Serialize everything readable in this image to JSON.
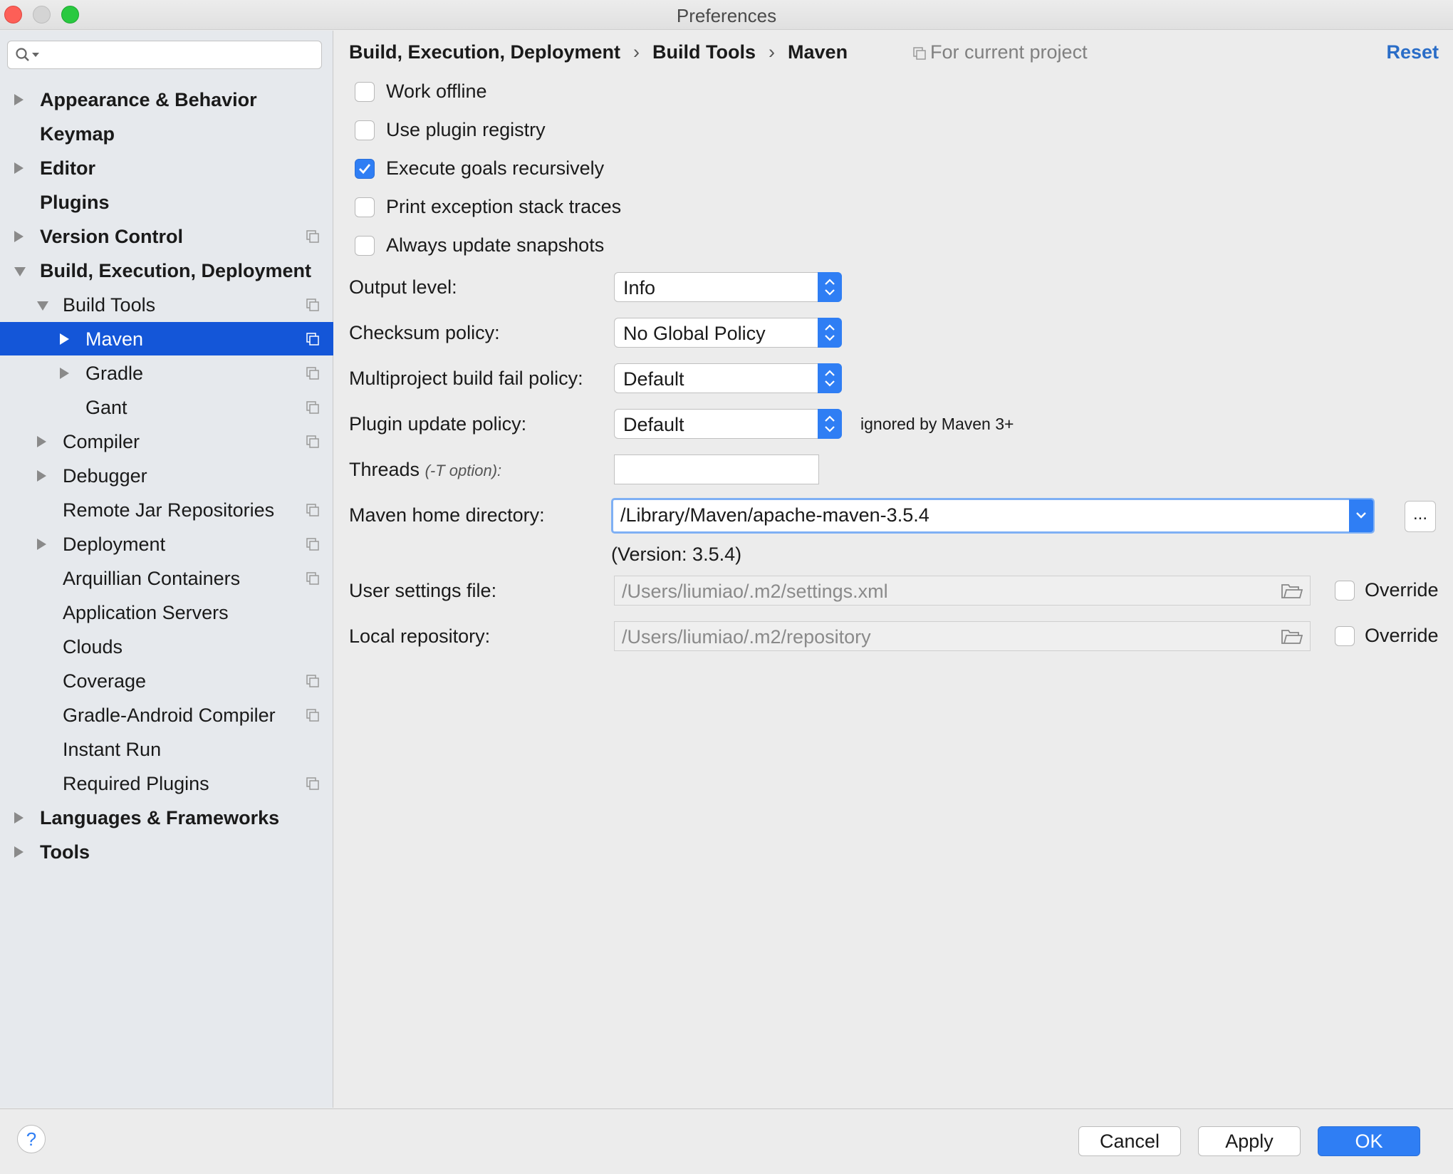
{
  "window": {
    "title": "Preferences"
  },
  "sidebar": {
    "items": [
      {
        "label": "Appearance & Behavior",
        "level": 0,
        "arrow": "right",
        "bold": true,
        "proj": false
      },
      {
        "label": "Keymap",
        "level": 0,
        "arrow": "none",
        "bold": true,
        "proj": false
      },
      {
        "label": "Editor",
        "level": 0,
        "arrow": "right",
        "bold": true,
        "proj": false
      },
      {
        "label": "Plugins",
        "level": 0,
        "arrow": "none",
        "bold": true,
        "proj": false
      },
      {
        "label": "Version Control",
        "level": 0,
        "arrow": "right",
        "bold": true,
        "proj": true
      },
      {
        "label": "Build, Execution, Deployment",
        "level": 0,
        "arrow": "down",
        "bold": true,
        "proj": false
      },
      {
        "label": "Build Tools",
        "level": 1,
        "arrow": "down",
        "bold": false,
        "proj": true
      },
      {
        "label": "Maven",
        "level": 2,
        "arrow": "right",
        "bold": false,
        "proj": true,
        "selected": true
      },
      {
        "label": "Gradle",
        "level": 2,
        "arrow": "right",
        "bold": false,
        "proj": true
      },
      {
        "label": "Gant",
        "level": 2,
        "arrow": "none",
        "bold": false,
        "proj": true
      },
      {
        "label": "Compiler",
        "level": 1,
        "arrow": "right",
        "bold": false,
        "proj": true
      },
      {
        "label": "Debugger",
        "level": 1,
        "arrow": "right",
        "bold": false,
        "proj": false
      },
      {
        "label": "Remote Jar Repositories",
        "level": 1,
        "arrow": "none",
        "bold": false,
        "proj": true
      },
      {
        "label": "Deployment",
        "level": 1,
        "arrow": "right",
        "bold": false,
        "proj": true
      },
      {
        "label": "Arquillian Containers",
        "level": 1,
        "arrow": "none",
        "bold": false,
        "proj": true
      },
      {
        "label": "Application Servers",
        "level": 1,
        "arrow": "none",
        "bold": false,
        "proj": false
      },
      {
        "label": "Clouds",
        "level": 1,
        "arrow": "none",
        "bold": false,
        "proj": false
      },
      {
        "label": "Coverage",
        "level": 1,
        "arrow": "none",
        "bold": false,
        "proj": true
      },
      {
        "label": "Gradle-Android Compiler",
        "level": 1,
        "arrow": "none",
        "bold": false,
        "proj": true
      },
      {
        "label": "Instant Run",
        "level": 1,
        "arrow": "none",
        "bold": false,
        "proj": false
      },
      {
        "label": "Required Plugins",
        "level": 1,
        "arrow": "none",
        "bold": false,
        "proj": true
      },
      {
        "label": "Languages & Frameworks",
        "level": 0,
        "arrow": "right",
        "bold": true,
        "proj": false
      },
      {
        "label": "Tools",
        "level": 0,
        "arrow": "right",
        "bold": true,
        "proj": false
      }
    ]
  },
  "header": {
    "breadcrumb": [
      "Build, Execution, Deployment",
      "Build Tools",
      "Maven"
    ],
    "separator": "›",
    "for_project": "For current project",
    "reset": "Reset"
  },
  "options": {
    "work_offline": {
      "label": "Work offline",
      "checked": false
    },
    "use_plugin_registry": {
      "label": "Use plugin registry",
      "checked": false
    },
    "execute_goals": {
      "label": "Execute goals recursively",
      "checked": true
    },
    "print_exceptions": {
      "label": "Print exception stack traces",
      "checked": false
    },
    "always_update": {
      "label": "Always update snapshots",
      "checked": false
    }
  },
  "form": {
    "output_level": {
      "label": "Output level:",
      "value": "Info"
    },
    "checksum_policy": {
      "label": "Checksum policy:",
      "value": "No Global Policy"
    },
    "multiproject_policy": {
      "label": "Multiproject build fail policy:",
      "value": "Default"
    },
    "plugin_update_policy": {
      "label": "Plugin update policy:",
      "value": "Default",
      "note": "ignored by Maven 3+"
    },
    "threads": {
      "label": "Threads",
      "hint": "(-T option):",
      "value": ""
    },
    "maven_home": {
      "label": "Maven home directory:",
      "value": "/Library/Maven/apache-maven-3.5.4",
      "browse": "...",
      "version": "(Version: 3.5.4)"
    },
    "user_settings": {
      "label": "User settings file:",
      "value": "/Users/liumiao/.m2/settings.xml",
      "override_label": "Override",
      "override": false
    },
    "local_repository": {
      "label": "Local repository:",
      "value": "/Users/liumiao/.m2/repository",
      "override_label": "Override",
      "override": false
    }
  },
  "footer": {
    "help": "?",
    "cancel": "Cancel",
    "apply": "Apply",
    "ok": "OK"
  },
  "colors": {
    "accent": "#2f7ef4",
    "selection": "#1456d8",
    "link": "#2a6dc7"
  }
}
